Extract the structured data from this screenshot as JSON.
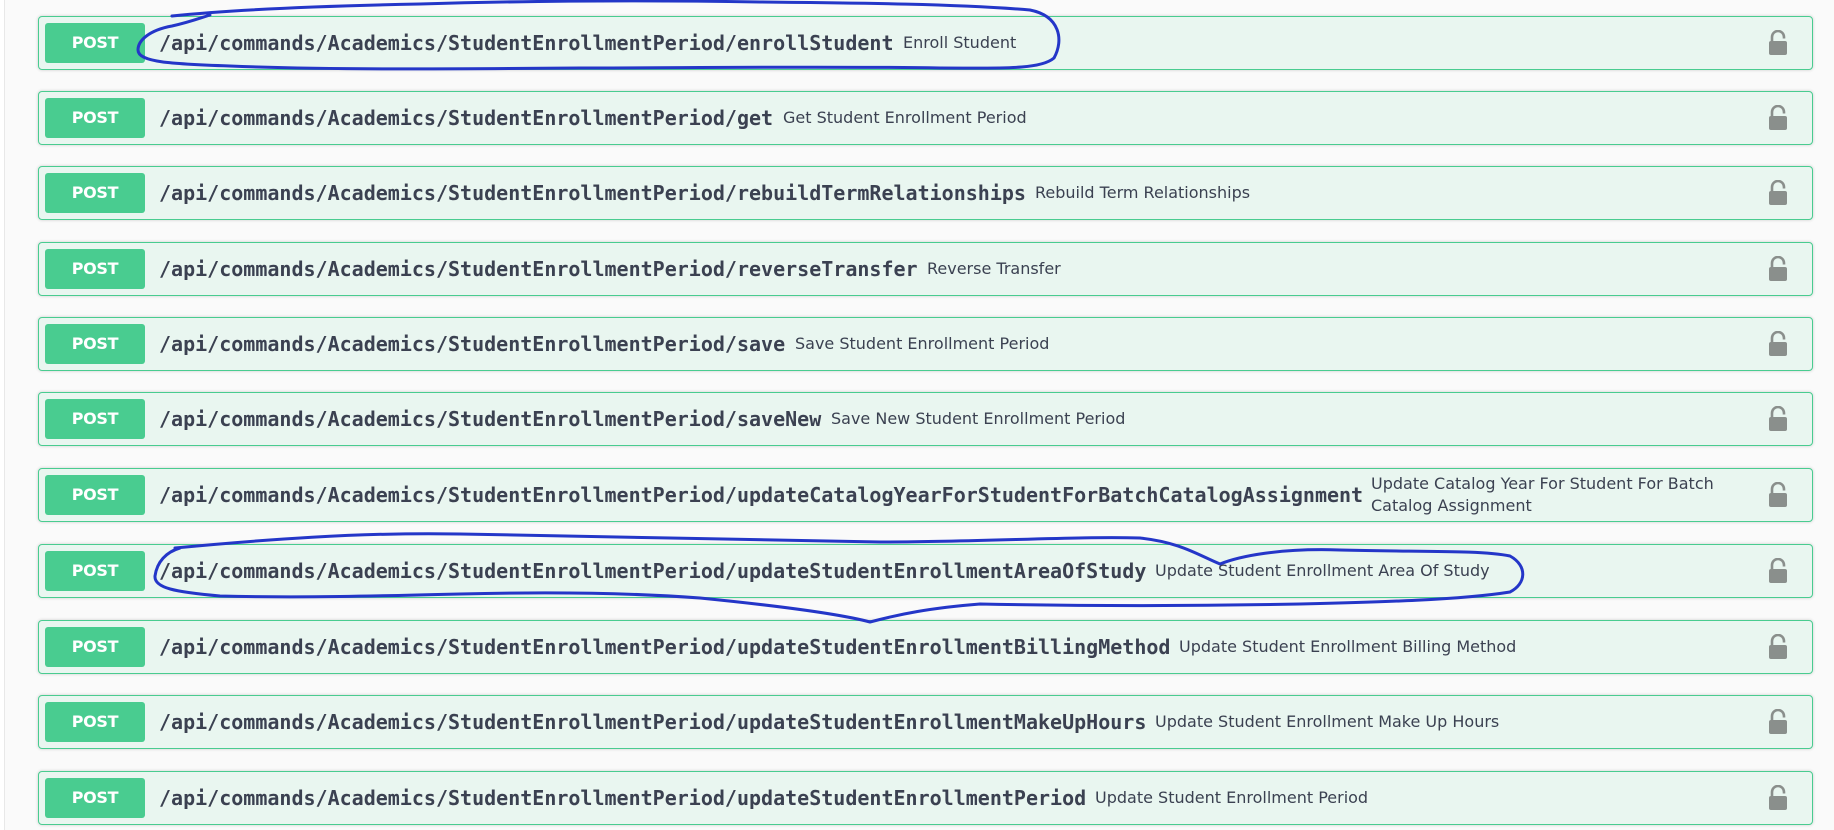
{
  "colors": {
    "post_accent": "#49cc90",
    "row_background": "#e9f6f0",
    "text": "#3b4151",
    "lock_icon": "#8a8f8c",
    "annotation_ink": "#2436c8"
  },
  "operations": [
    {
      "method": "POST",
      "path": "/api/commands/Academics/StudentEnrollmentPeriod/enrollStudent",
      "summary": "Enroll Student",
      "icon": "unlocked-padlock-icon"
    },
    {
      "method": "POST",
      "path": "/api/commands/Academics/StudentEnrollmentPeriod/get",
      "summary": "Get Student Enrollment Period",
      "icon": "unlocked-padlock-icon"
    },
    {
      "method": "POST",
      "path": "/api/commands/Academics/StudentEnrollmentPeriod/rebuildTermRelationships",
      "summary": "Rebuild Term Relationships",
      "icon": "unlocked-padlock-icon"
    },
    {
      "method": "POST",
      "path": "/api/commands/Academics/StudentEnrollmentPeriod/reverseTransfer",
      "summary": "Reverse Transfer",
      "icon": "unlocked-padlock-icon"
    },
    {
      "method": "POST",
      "path": "/api/commands/Academics/StudentEnrollmentPeriod/save",
      "summary": "Save Student Enrollment Period",
      "icon": "unlocked-padlock-icon"
    },
    {
      "method": "POST",
      "path": "/api/commands/Academics/StudentEnrollmentPeriod/saveNew",
      "summary": "Save New Student Enrollment Period",
      "icon": "unlocked-padlock-icon"
    },
    {
      "method": "POST",
      "path": "/api/commands/Academics/StudentEnrollmentPeriod/updateCatalogYearForStudentForBatchCatalogAssignment",
      "summary": "Update Catalog Year For Student For Batch Catalog Assignment",
      "icon": "unlocked-padlock-icon"
    },
    {
      "method": "POST",
      "path": "/api/commands/Academics/StudentEnrollmentPeriod/updateStudentEnrollmentAreaOfStudy",
      "summary": "Update Student Enrollment Area Of Study",
      "icon": "unlocked-padlock-icon"
    },
    {
      "method": "POST",
      "path": "/api/commands/Academics/StudentEnrollmentPeriod/updateStudentEnrollmentBillingMethod",
      "summary": "Update Student Enrollment Billing Method",
      "icon": "unlocked-padlock-icon"
    },
    {
      "method": "POST",
      "path": "/api/commands/Academics/StudentEnrollmentPeriod/updateStudentEnrollmentMakeUpHours",
      "summary": "Update Student Enrollment Make Up Hours",
      "icon": "unlocked-padlock-icon"
    },
    {
      "method": "POST",
      "path": "/api/commands/Academics/StudentEnrollmentPeriod/updateStudentEnrollmentPeriod",
      "summary": "Update Student Enrollment Period",
      "icon": "unlocked-padlock-icon"
    }
  ],
  "annotations": [
    {
      "kind": "hand-drawn-circle",
      "target": "/api/commands/Academics/StudentEnrollmentPeriod/enrollStudent"
    },
    {
      "kind": "hand-drawn-circle",
      "target": "/api/commands/Academics/StudentEnrollmentPeriod/updateStudentEnrollmentAreaOfStudy"
    }
  ]
}
